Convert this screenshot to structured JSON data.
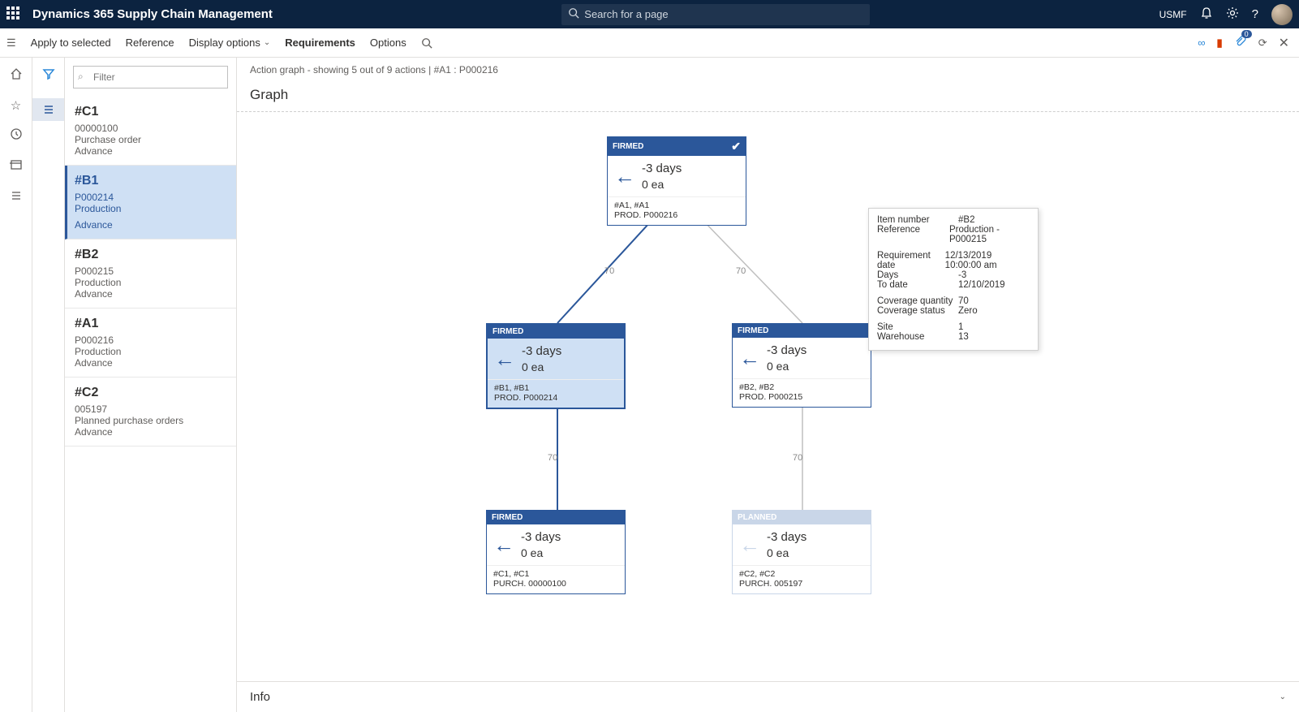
{
  "topbar": {
    "title": "Dynamics 365 Supply Chain Management",
    "search_placeholder": "Search for a page",
    "entity": "USMF"
  },
  "cmdbar": {
    "apply": "Apply to selected",
    "reference": "Reference",
    "display": "Display options",
    "requirements": "Requirements",
    "options": "Options"
  },
  "filter_placeholder": "Filter",
  "list": [
    {
      "id": "#C1",
      "no": "00000100",
      "type": "Purchase order",
      "action": "Advance",
      "selected": false
    },
    {
      "id": "#B1",
      "no": "P000214",
      "type": "Production",
      "action": "Advance",
      "selected": true
    },
    {
      "id": "#B2",
      "no": "P000215",
      "type": "Production",
      "action": "Advance",
      "selected": false
    },
    {
      "id": "#A1",
      "no": "P000216",
      "type": "Production",
      "action": "Advance",
      "selected": false
    },
    {
      "id": "#C2",
      "no": "005197",
      "type": "Planned purchase orders",
      "action": "Advance",
      "selected": false
    }
  ],
  "crumb": "Action graph - showing 5 out of 9 actions   |   #A1 : P000216",
  "graph_title": "Graph",
  "nodes": {
    "n0": {
      "status": "FIRMED",
      "days": "-3 days",
      "qty": "0 ea",
      "refs": "#A1, #A1",
      "doc": "PROD. P000216",
      "check": true
    },
    "n1": {
      "status": "FIRMED",
      "days": "-3 days",
      "qty": "0 ea",
      "refs": "#B1, #B1",
      "doc": "PROD. P000214"
    },
    "n2": {
      "status": "FIRMED",
      "days": "-3 days",
      "qty": "0 ea",
      "refs": "#B2, #B2",
      "doc": "PROD. P000215"
    },
    "n3": {
      "status": "FIRMED",
      "days": "-3 days",
      "qty": "0 ea",
      "refs": "#C1, #C1",
      "doc": "PURCH. 00000100"
    },
    "n4": {
      "status": "PLANNED",
      "days": "-3 days",
      "qty": "0 ea",
      "refs": "#C2, #C2",
      "doc": "PURCH. 005197"
    }
  },
  "edges": {
    "e01": "70",
    "e02": "70",
    "e13": "70",
    "e24": "70"
  },
  "tooltip": {
    "item_k": "Item number",
    "item_v": "#B2",
    "ref_k": "Reference",
    "ref_v": "Production - P000215",
    "reqdate_k": "Requirement date",
    "reqdate_v": "12/13/2019 10:00:00 am",
    "days_k": "Days",
    "days_v": "-3",
    "todate_k": "To date",
    "todate_v": "12/10/2019",
    "covqty_k": "Coverage quantity",
    "covqty_v": "70",
    "covst_k": "Coverage status",
    "covst_v": "Zero",
    "site_k": "Site",
    "site_v": "1",
    "wh_k": "Warehouse",
    "wh_v": "13"
  },
  "info_title": "Info"
}
